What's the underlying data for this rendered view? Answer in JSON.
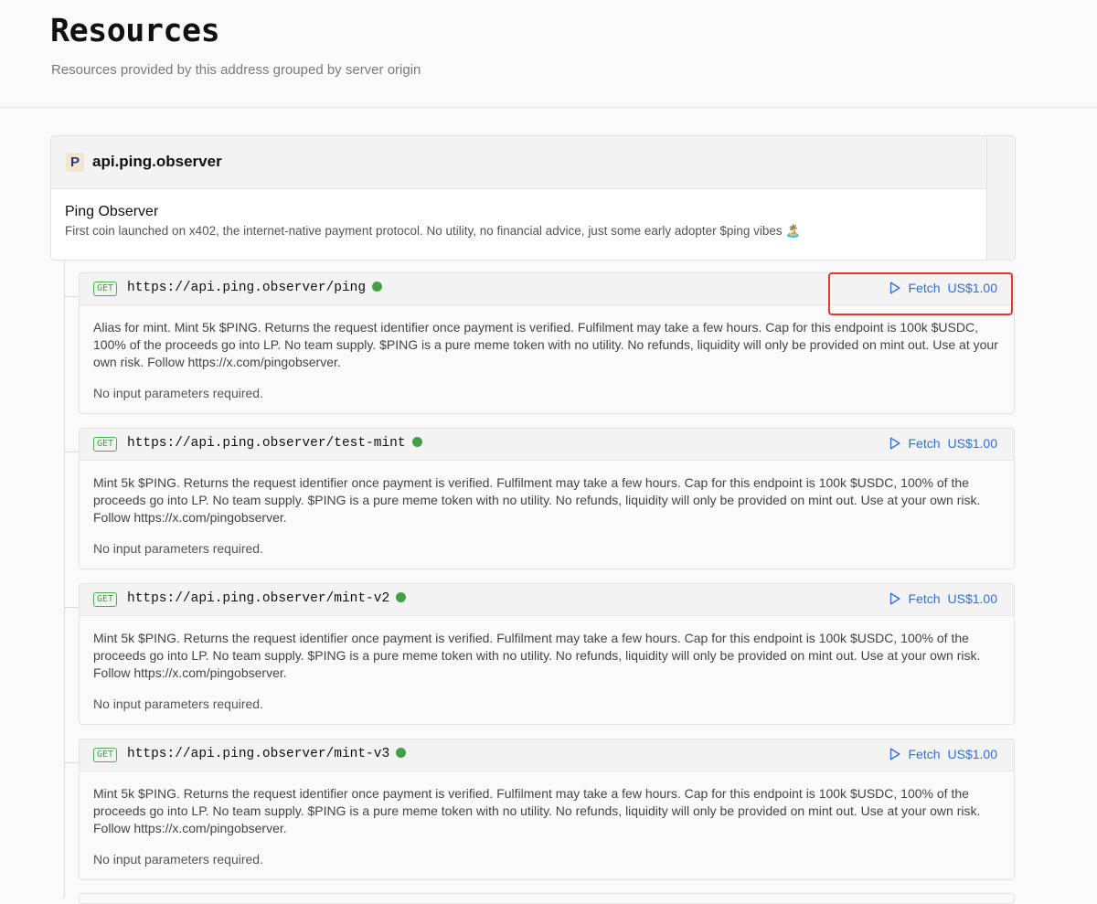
{
  "page": {
    "title": "Resources",
    "subtitle": "Resources provided by this address grouped by server origin"
  },
  "origin": {
    "logo_letter": "P",
    "name": "api.ping.observer",
    "service_name": "Ping Observer",
    "service_description": "First coin launched on x402, the internet-native payment protocol. No utility, no financial advice, just some early adopter $ping vibes 🏝️"
  },
  "endpoints": [
    {
      "method": "GET",
      "url": "https://api.ping.observer/ping",
      "fetch_label": "Fetch",
      "price": "US$1.00",
      "description": "Alias for mint. Mint 5k $PING. Returns the request identifier once payment is verified. Fulfilment may take a few hours. Cap for this endpoint is 100k $USDC, 100% of the proceeds go into LP. No team supply. $PING is a pure meme token with no utility. No refunds, liquidity will only be provided on mint out. Use at your own risk. Follow https://x.com/pingobserver.",
      "params": "No input parameters required."
    },
    {
      "method": "GET",
      "url": "https://api.ping.observer/test-mint",
      "fetch_label": "Fetch",
      "price": "US$1.00",
      "description": "Mint 5k $PING. Returns the request identifier once payment is verified. Fulfilment may take a few hours. Cap for this endpoint is 100k $USDC, 100% of the proceeds go into LP. No team supply. $PING is a pure meme token with no utility. No refunds, liquidity will only be provided on mint out. Use at your own risk. Follow https://x.com/pingobserver.",
      "params": "No input parameters required."
    },
    {
      "method": "GET",
      "url": "https://api.ping.observer/mint-v2",
      "fetch_label": "Fetch",
      "price": "US$1.00",
      "description": "Mint 5k $PING. Returns the request identifier once payment is verified. Fulfilment may take a few hours. Cap for this endpoint is 100k $USDC, 100% of the proceeds go into LP. No team supply. $PING is a pure meme token with no utility. No refunds, liquidity will only be provided on mint out. Use at your own risk. Follow https://x.com/pingobserver.",
      "params": "No input parameters required."
    },
    {
      "method": "GET",
      "url": "https://api.ping.observer/mint-v3",
      "fetch_label": "Fetch",
      "price": "US$1.00",
      "description": "Mint 5k $PING. Returns the request identifier once payment is verified. Fulfilment may take a few hours. Cap for this endpoint is 100k $USDC, 100% of the proceeds go into LP. No team supply. $PING is a pure meme token with no utility. No refunds, liquidity will only be provided on mint out. Use at your own risk. Follow https://x.com/pingobserver.",
      "params": "No input parameters required."
    }
  ],
  "colors": {
    "accent": "#2f6fd6",
    "status_ok": "#43a047",
    "highlight": "#e03a2f"
  },
  "icons": {
    "fetch": "play-icon",
    "status": "status-dot-icon"
  }
}
